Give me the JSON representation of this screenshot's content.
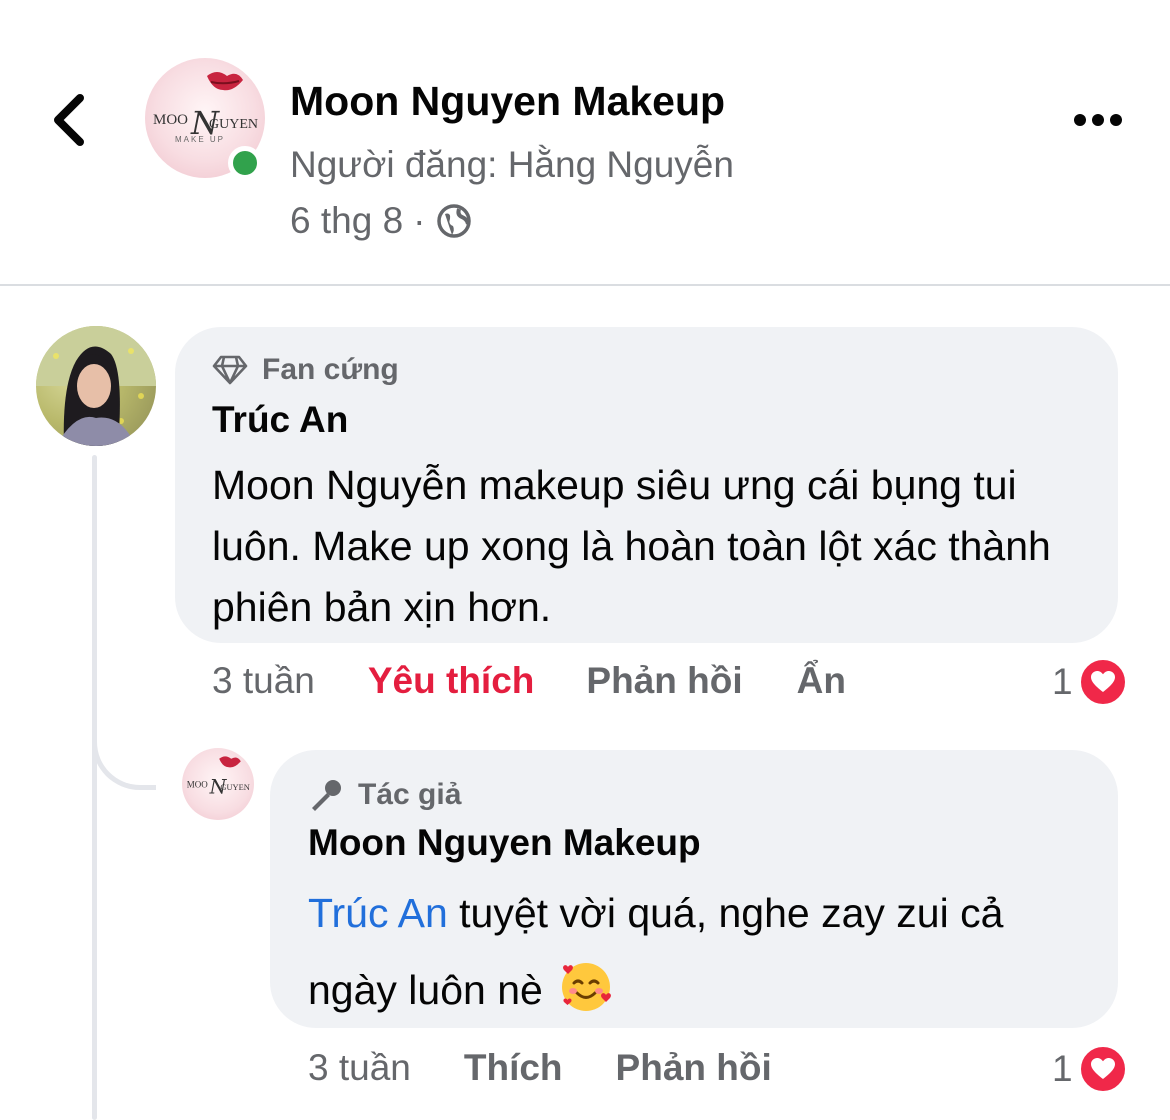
{
  "header": {
    "back_icon": "chevron-left-icon",
    "page_name": "Moon Nguyen Makeup",
    "posted_by": "Người đăng: Hằng Nguyễn",
    "date": "6 thg 8",
    "separator": "·",
    "audience_icon": "globe-icon",
    "more_icon": "more-horizontal-icon",
    "online_color": "#31a24c",
    "logo_text": {
      "left": "MOO",
      "n": "N",
      "right": "GUYEN",
      "sub": "MAKE UP"
    }
  },
  "comments": [
    {
      "badge_icon": "diamond-icon",
      "badge": "Fan cứng",
      "author": "Trúc An",
      "text": "Moon Nguyễn makeup siêu ưng cái bụng tui luôn. Make up xong là hoàn toàn lột xác thành phiên bản xịn hơn.",
      "time": "3 tuần",
      "like_label": "Yêu thích",
      "like_color": "#e41e3f",
      "reply_label": "Phản hồi",
      "hide_label": "Ẩn",
      "reaction_count": "1",
      "reaction_icon": "heart-icon",
      "reply": {
        "badge_icon": "microphone-icon",
        "badge": "Tác giả",
        "author": "Moon Nguyen Makeup",
        "mention": "Trúc An",
        "text": " tuyệt vời quá, nghe zay zui cả ngày luôn nè",
        "emoji": "smiling-face-with-hearts-icon",
        "time": "3 tuần",
        "like_label": "Thích",
        "reply_label": "Phản hồi",
        "reaction_count": "1",
        "reaction_icon": "heart-icon"
      }
    }
  ],
  "colors": {
    "bubble": "#f0f2f5",
    "secondary_text": "#65676b",
    "mention": "#216fdb",
    "heart": "#f02849"
  }
}
